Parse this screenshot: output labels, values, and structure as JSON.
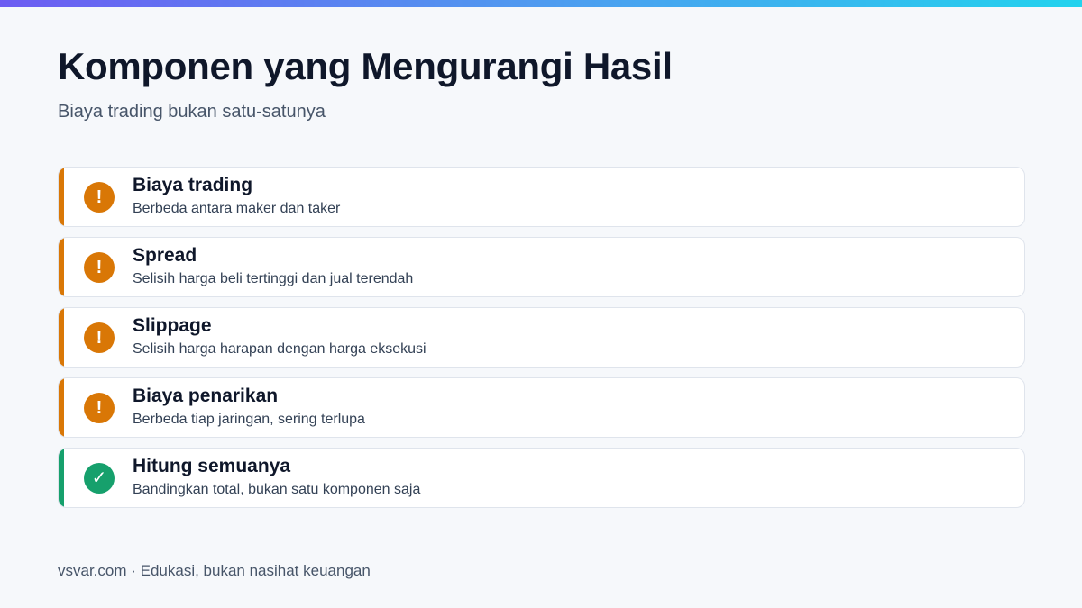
{
  "title": "Komponen yang Mengurangi Hasil",
  "subtitle": "Biaya trading bukan satu-satunya",
  "items": [
    {
      "heading": "Biaya trading",
      "description": "Berbeda antara maker dan taker",
      "icon": "!",
      "icon_name": "warning-icon",
      "status": "warn"
    },
    {
      "heading": "Spread",
      "description": "Selisih harga beli tertinggi dan jual terendah",
      "icon": "!",
      "icon_name": "warning-icon",
      "status": "warn"
    },
    {
      "heading": "Slippage",
      "description": "Selisih harga harapan dengan harga eksekusi",
      "icon": "!",
      "icon_name": "warning-icon",
      "status": "warn"
    },
    {
      "heading": "Biaya penarikan",
      "description": "Berbeda tiap jaringan, sering terlupa",
      "icon": "!",
      "icon_name": "warning-icon",
      "status": "warn"
    },
    {
      "heading": "Hitung semuanya",
      "description": "Bandingkan total, bukan satu komponen saja",
      "icon": "✓",
      "icon_name": "check-icon",
      "status": "ok"
    }
  ],
  "footer": "vsvar.com · Edukasi, bukan nasihat keuangan",
  "colors": {
    "warning": "#d97706",
    "success": "#16a06c",
    "gradient_start": "#6d5cf2",
    "gradient_end": "#22d3ee"
  }
}
